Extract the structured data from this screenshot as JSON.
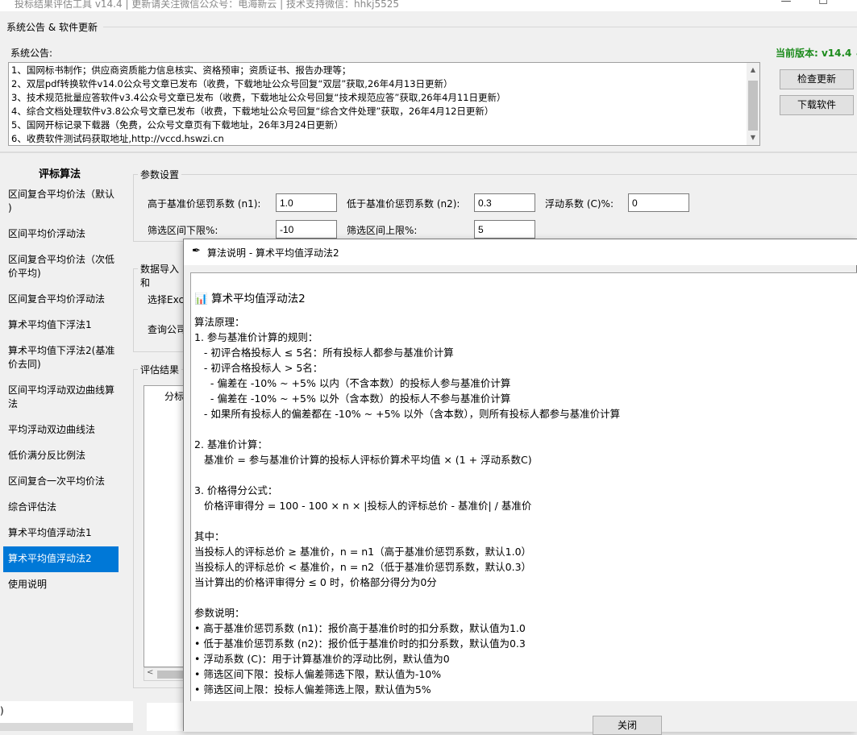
{
  "window": {
    "title": "投标结果评估工具 v14.4 | 更新请关注微信公众号：电海新云 | 技术支持微信：hhkj5525",
    "minimize_glyph": "—",
    "maximize_glyph": "☐"
  },
  "announcement": {
    "section_title": "系统公告 & 软件更新",
    "label": "系统公告:",
    "items": [
      "1、国网标书制作；供应商资质能力信息核实、资格预审；资质证书、报告办理等；",
      "2、双层pdf转换软件v14.0公众号文章已发布（收费，下载地址公众号回复“双层”获取,26年4月13日更新）",
      "3、技术规范批量应答软件v3.4公众号文章已发布（收费，下载地址公众号回复“技术规范应答”获取,26年4月11日更新）",
      "4、综合文档处理软件v3.8公众号文章已发布（收费，下载地址公众号回复“综合文件处理”获取，26年4月12日更新）",
      "5、国网开标记录下载器（免费，公众号文章页有下载地址，26年3月24日更新）",
      "6、收费软件测试码获取地址,http://vccd.hswzi.cn"
    ],
    "scroll_up_glyph": "▲",
    "scroll_down_glyph": "▼"
  },
  "version": {
    "label": "当前版本: v14.4 ✓",
    "color": "#1a8a1a"
  },
  "buttons": {
    "check_update": "检查更新",
    "download": "下载软件"
  },
  "nav": {
    "title": "评标算法",
    "items": [
      "区间复合平均价法（默认",
      ")",
      "区间平均价浮动法",
      "区间复合平均价法（次低",
      "价平均)",
      "区间复合平均价浮动法",
      "算术平均值下浮法1",
      "算术平均值下浮法2(基准",
      "价去同)",
      "区间平均浮动双边曲线算",
      "法",
      "平均浮动双边曲线法",
      "低价满分反比例法",
      "区间复合一次平均价法",
      "综合评估法",
      "算术平均值浮动法1",
      "算术平均值浮动法2",
      "使用说明"
    ],
    "active_label": "算术平均值浮动法2",
    "active_color": "#0078d7"
  },
  "params": {
    "frame_title": "参数设置",
    "n1_label": "高于基准价惩罚系数 (n1):",
    "n1_value": "1.0",
    "n2_label": "低于基准价惩罚系数 (n2):",
    "n2_value": "0.3",
    "c_label": "浮动系数 (C)%:",
    "c_value": "0",
    "lower_label": "筛选区间下限%:",
    "lower_value": "-10",
    "upper_label": "筛选区间上限%:",
    "upper_value": "5"
  },
  "data_import": {
    "frame_title": "数据导入和",
    "select_label": "选择Exc",
    "query_label": "查询公司"
  },
  "results": {
    "frame_title": "评估结果",
    "column_fragment": "分标",
    "scroll_left_glyph": "<"
  },
  "bottom_strip": {
    "fragment": ")"
  },
  "dialog": {
    "icon": "feather-icon",
    "title": "算法说明 - 算术平均值浮动法2",
    "heading": "📊 算术平均值浮动法2",
    "lines": [
      "",
      "算法原理：",
      "1. 参与基准价计算的规则：",
      "   - 初评合格投标人 ≤ 5名：所有投标人都参与基准价计算",
      "   - 初评合格投标人 > 5名：",
      "     - 偏差在 -10% ~ +5% 以内（不含本数）的投标人参与基准价计算",
      "     - 偏差在 -10% ~ +5% 以外（含本数）的投标人不参与基准价计算",
      "   - 如果所有投标人的偏差都在 -10% ~ +5% 以外（含本数），则所有投标人都参与基准价计算",
      "",
      "2. 基准价计算：",
      "   基准价 = 参与基准价计算的投标人评标价算术平均值 × (1 + 浮动系数C)",
      "",
      "3. 价格得分公式：",
      "   价格评审得分 = 100 - 100 × n × |投标人的评标总价 - 基准价| / 基准价",
      "",
      "其中：",
      "当投标人的评标总价 ≥ 基准价，n = n1（高于基准价惩罚系数，默认1.0）",
      "当投标人的评标总价 < 基准价，n = n2（低于基准价惩罚系数，默认0.3）",
      "当计算出的价格评审得分 ≤ 0 时，价格部分得分为0分",
      "",
      "参数说明：",
      "• 高于基准价惩罚系数 (n1)：报价高于基准价时的扣分系数，默认值为1.0",
      "• 低于基准价惩罚系数 (n2)：报价低于基准价时的扣分系数，默认值为0.3",
      "• 浮动系数 (C)：用于计算基准价的浮动比例，默认值为0",
      "• 筛选区间下限：投标人偏差筛选下限，默认值为-10%",
      "• 筛选区间上限：投标人偏差筛选上限，默认值为5%"
    ],
    "close_button": "关闭"
  }
}
